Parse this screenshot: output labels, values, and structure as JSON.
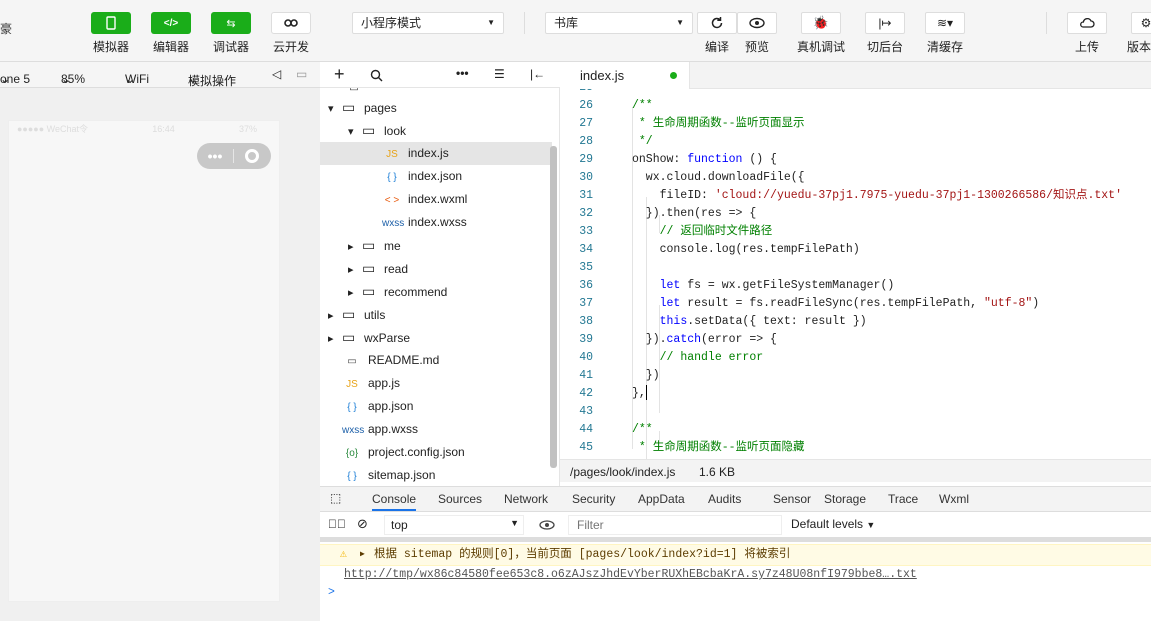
{
  "toolbar": {
    "left_cut": "豪",
    "simulator_label": "模拟器",
    "editor_label": "编辑器",
    "debugger_label": "调试器",
    "cloud_label": "云开发",
    "mode_select": "小程序模式",
    "project_select": "书库",
    "compile_label": "编译",
    "preview_label": "预览",
    "remote_debug_label": "真机调试",
    "background_label": "切后台",
    "clear_cache_label": "清缓存",
    "upload_label": "上传",
    "version_label": "版本"
  },
  "sim_toolbar": {
    "device": "one 5",
    "zoom": "85%",
    "network": "WiFi",
    "mode": "模拟操作"
  },
  "phone": {
    "carrier": "●●●●● WeChat令",
    "time": "16:44",
    "battery": "37%"
  },
  "tree": {
    "items": [
      {
        "label": "pages",
        "type": "folder-open",
        "indent": 1
      },
      {
        "label": "look",
        "type": "folder-open",
        "indent": 2
      },
      {
        "label": "index.js",
        "type": "js",
        "indent": 3,
        "active": true
      },
      {
        "label": "index.json",
        "type": "json",
        "indent": 3
      },
      {
        "label": "index.wxml",
        "type": "wxml",
        "indent": 3
      },
      {
        "label": "index.wxss",
        "type": "wxss",
        "indent": 3
      },
      {
        "label": "me",
        "type": "folder",
        "indent": 2
      },
      {
        "label": "read",
        "type": "folder",
        "indent": 2
      },
      {
        "label": "recommend",
        "type": "folder",
        "indent": 2
      },
      {
        "label": "utils",
        "type": "folder",
        "indent": 1
      },
      {
        "label": "wxParse",
        "type": "folder",
        "indent": 1
      },
      {
        "label": "README.md",
        "type": "file",
        "indent": 1
      },
      {
        "label": "app.js",
        "type": "js",
        "indent": 1
      },
      {
        "label": "app.json",
        "type": "json",
        "indent": 1
      },
      {
        "label": "app.wxss",
        "type": "wxss",
        "indent": 1
      },
      {
        "label": "project.config.json",
        "type": "config",
        "indent": 1
      },
      {
        "label": "sitemap.json",
        "type": "json",
        "indent": 1
      }
    ]
  },
  "editor": {
    "tab": "index.js",
    "lines": [
      {
        "n": "25",
        "html": ""
      },
      {
        "n": "26",
        "html": "<span class='c-comment'>/**</span>"
      },
      {
        "n": "27",
        "html": "<span class='c-comment'> * 生命周期函数--监听页面显示</span>"
      },
      {
        "n": "28",
        "html": "<span class='c-comment'> */</span>"
      },
      {
        "n": "29",
        "html": "onShow: <span class='c-kw'>function</span> () {"
      },
      {
        "n": "30",
        "html": "  wx.cloud.downloadFile({"
      },
      {
        "n": "31",
        "html": "    fileID: <span class='c-str'>'cloud://yuedu-37pj1.7975-yuedu-37pj1-1300266586/知识点.txt'</span>"
      },
      {
        "n": "32",
        "html": "  }).then(res => {"
      },
      {
        "n": "33",
        "html": "    <span class='c-comment'>// 返回临时文件路径</span>"
      },
      {
        "n": "34",
        "html": "    console.log(res.tempFilePath)"
      },
      {
        "n": "35",
        "html": ""
      },
      {
        "n": "36",
        "html": "    <span class='c-kw'>let</span> fs = wx.getFileSystemManager()"
      },
      {
        "n": "37",
        "html": "    <span class='c-kw'>let</span> result = fs.readFileSync(res.tempFilePath, <span class='c-str'>\"utf-8\"</span>)"
      },
      {
        "n": "38",
        "html": "    <span class='c-kw'>this</span>.setData({ text: result })"
      },
      {
        "n": "39",
        "html": "  }).<span class='c-kw'>catch</span>(error => {"
      },
      {
        "n": "40",
        "html": "    <span class='c-comment'>// handle error</span>"
      },
      {
        "n": "41",
        "html": "  })"
      },
      {
        "n": "42",
        "html": "},<span class='cursor'></span>"
      },
      {
        "n": "43",
        "html": ""
      },
      {
        "n": "44",
        "html": "<span class='c-comment'>/**</span>"
      },
      {
        "n": "45",
        "html": "<span class='c-comment'> * 生命周期函数--监听页面隐藏</span>"
      }
    ]
  },
  "statusbar": {
    "path": "/pages/look/index.js",
    "size": "1.6 KB"
  },
  "devtools": {
    "tabs": [
      "Console",
      "Sources",
      "Network",
      "Security",
      "AppData",
      "Audits",
      "Sensor",
      "Storage",
      "Trace",
      "Wxml"
    ],
    "context": "top",
    "filter_placeholder": "Filter",
    "levels": "Default levels"
  },
  "console": {
    "warning": "根据 sitemap 的规则[0]，当前页面 [pages/look/index?id=1] 将被索引",
    "link": "http://tmp/wx86c84580fee653c8.o6zAJszJhdEvYberRUXhEBcbaKrA.sy7z48U08nfI979bbe8….txt",
    "prompt": ">"
  }
}
